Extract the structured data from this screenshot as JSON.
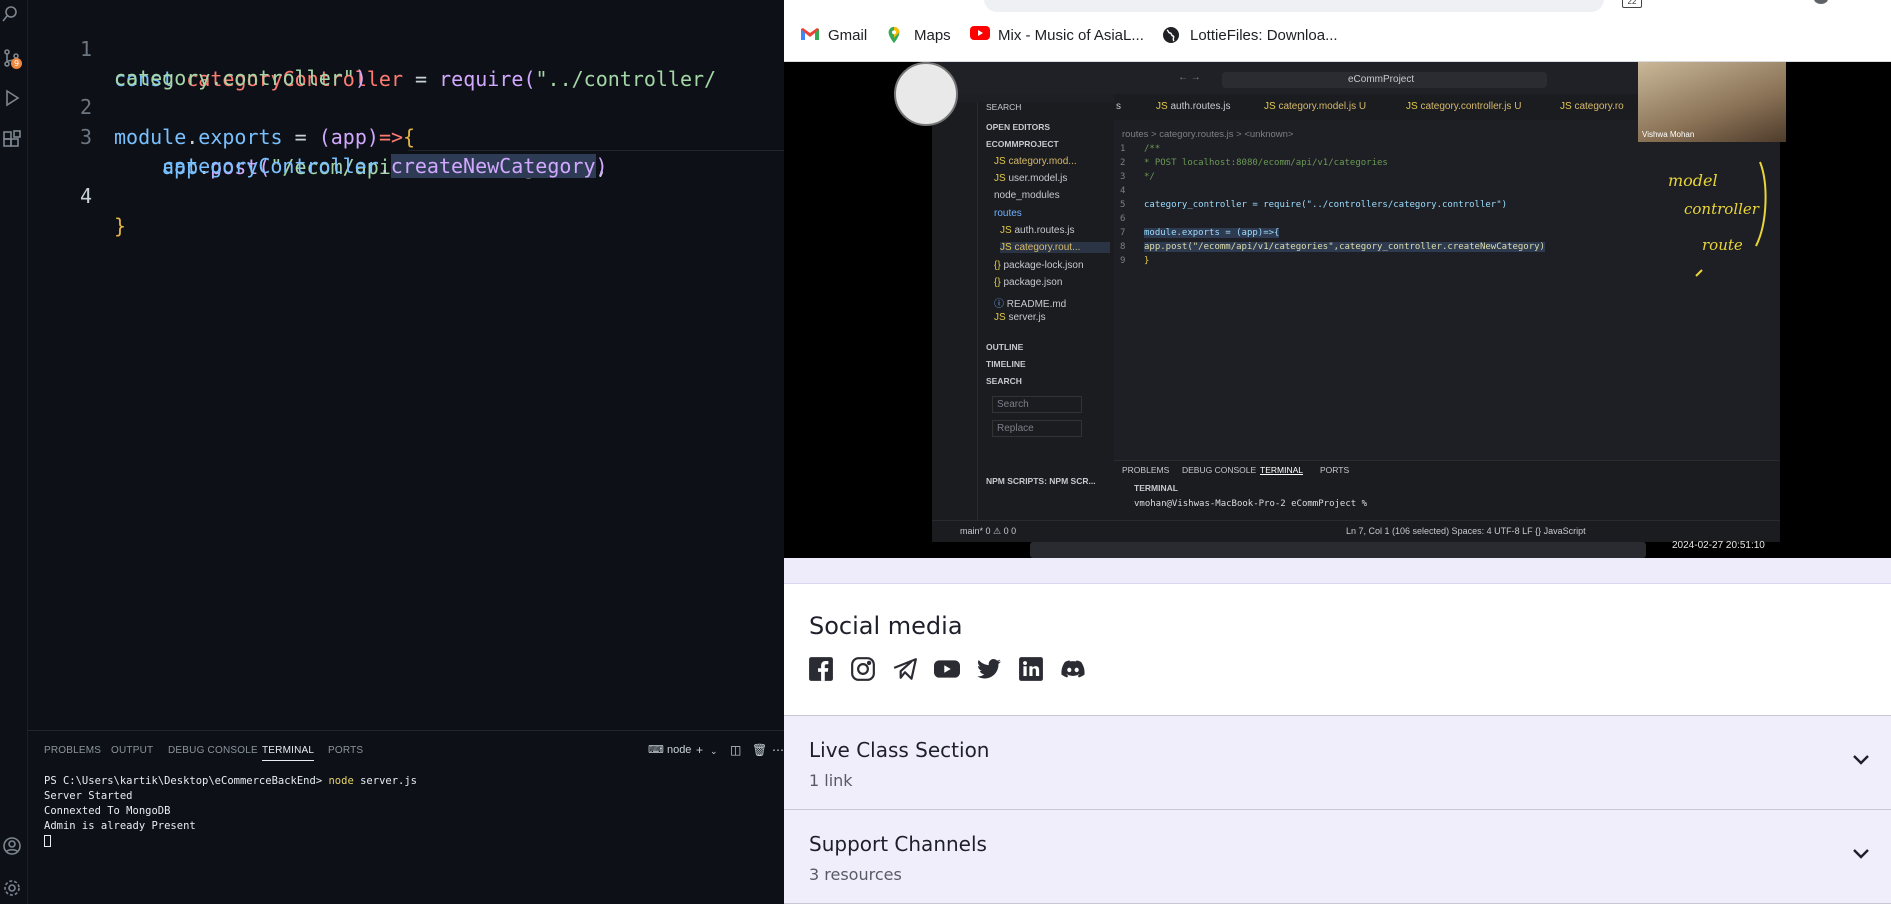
{
  "vscode": {
    "activity_badges": [
      "9"
    ],
    "code": {
      "line_numbers": [
        "1",
        "2",
        "3",
        "4"
      ],
      "l1_kw": "const",
      "l1_var": "categoryController",
      "l1_eq": " = ",
      "l1_fn": "require",
      "l1_open": "(",
      "l1_str_a": "\"../controller/",
      "l1_str_b": "category.controller\"",
      "l1_close": ")",
      "l2_obj": "module",
      "l2_dot": ".",
      "l2_prop": "exports",
      "l2_eq": " = ",
      "l2_params": "(app)",
      "l2_arrow": "=>",
      "l2_brace": "{",
      "l3_obj": "app",
      "l3_dot": ".",
      "l3_fn": "post",
      "l3_open": "(",
      "l3_str": "\"/ecom/api/v1/auth/signin\"",
      "l3_comma": " ,",
      "l3b_obj": "categoryController",
      "l3b_dot": ".",
      "l3b_method": "createNewCategory",
      "l3b_close": ")",
      "l4_brace": "}"
    },
    "panel": {
      "tabs": [
        "PROBLEMS",
        "OUTPUT",
        "DEBUG CONSOLE",
        "TERMINAL",
        "PORTS"
      ],
      "active_tab": "TERMINAL",
      "terminal_label": "node",
      "terminal_lines": {
        "prompt": "PS C:\\Users\\kartik\\Desktop\\eCommerceBackEnd> ",
        "command": "node",
        "command_arg": " server.js",
        "l2": "Server Started",
        "l3": "Connexted To MongoDB",
        "l4": "Admin is already Present"
      }
    }
  },
  "browser": {
    "tab_count": "22",
    "bookmarks": [
      "Gmail",
      "Maps",
      "Mix - Music of AsiaL...",
      "LottieFiles: Downloa..."
    ],
    "video": {
      "title": "eCommProject",
      "sidebar_search": "SEARCH",
      "open_editors": "OPEN EDITORS",
      "project": "ECOMMPROJECT",
      "files": [
        "category.mod...",
        "user.model.js",
        "node_modules",
        "routes",
        "auth.routes.js",
        "category.rout...",
        "package-lock.json",
        "package.json",
        "README.md",
        "server.js"
      ],
      "file_flags": [
        "U",
        "",
        "",
        "",
        "",
        "U",
        "",
        "",
        "",
        ""
      ],
      "outline": "OUTLINE",
      "timeline": "TIMELINE",
      "search2": "SEARCH",
      "search_placeholder": "Search",
      "replace_placeholder": "Replace",
      "npm": "NPM SCRIPTS: NPM SCR...",
      "tabs": [
        "s",
        "auth.routes.js",
        "category.model.js U",
        "category.controller.js U",
        "category.ro"
      ],
      "breadcrumb": "routes > category.routes.js > <unknown>",
      "code_lines": [
        "/**",
        " * POST localhost:8080/ecomm/api/v1/categories",
        " */",
        "",
        "category_controller = require(\"../controllers/category.controller\")",
        "",
        "module.exports = (app)=>{",
        "    app.post(\"/ecomm/api/v1/categories\",category_controller.createNewCategory)",
        "}"
      ],
      "panel_tabs": [
        "PROBLEMS",
        "DEBUG CONSOLE",
        "TERMINAL",
        "PORTS"
      ],
      "terminal_header": "TERMINAL",
      "terminal_prompt": "vmohan@Vishwas-MacBook-Pro-2 eCommProject % ",
      "status_left": "main*  0 ⚠ 0  0",
      "status_right": "Ln 7, Col 1 (106 selected)   Spaces: 4   UTF-8   LF   {} JavaScript",
      "webcam_name": "Vishwa Mohan",
      "timestamp": "2024-02-27  20:51:10",
      "handwriting": [
        "model",
        "controller",
        "route"
      ]
    },
    "social": {
      "title": "Social media",
      "icons": [
        "facebook-icon",
        "instagram-icon",
        "telegram-icon",
        "youtube-icon",
        "twitter-icon",
        "linkedin-icon",
        "discord-icon"
      ]
    },
    "sections": [
      {
        "title": "Live Class Section",
        "sub": "1 link"
      },
      {
        "title": "Support Channels",
        "sub": "3 resources"
      }
    ]
  }
}
